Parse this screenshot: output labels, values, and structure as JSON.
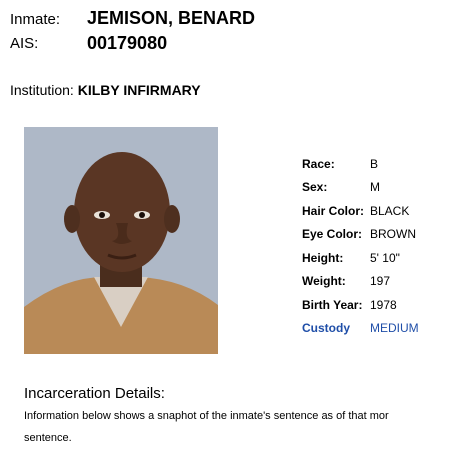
{
  "header": {
    "inmate_label": "Inmate:",
    "inmate_name": "JEMISON, BENARD",
    "ais_label": "AIS:",
    "ais_number": "00179080",
    "institution_label": "Institution:",
    "institution_name": "KILBY INFIRMARY"
  },
  "photo": {
    "alt": "Inmate photo"
  },
  "details": [
    {
      "label": "Race:",
      "value": "B"
    },
    {
      "label": "Sex:",
      "value": "M"
    },
    {
      "label": "Hair Color:",
      "value": "BLACK"
    },
    {
      "label": "Eye Color:",
      "value": "BROWN"
    },
    {
      "label": "Height:",
      "value": "5' 10\""
    },
    {
      "label": "Weight:",
      "value": "197"
    },
    {
      "label": "Birth Year:",
      "value": "1978"
    },
    {
      "label": "Custody",
      "value": "MEDIUM"
    }
  ],
  "incarceration": {
    "title": "Incarceration Details:",
    "line1": "Information below shows a snaphot of the inmate's sentence as of that mor",
    "line2": "sentence."
  },
  "colors": {
    "custody": "#1f4ea8",
    "photo_bg": "#aeb8c7"
  }
}
